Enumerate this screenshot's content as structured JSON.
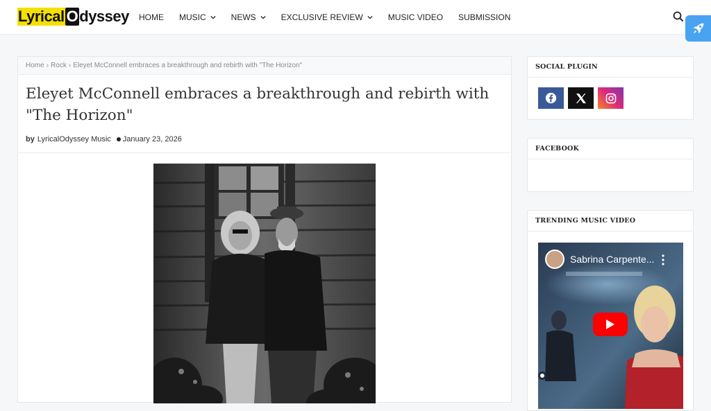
{
  "header": {
    "logo": {
      "part1": "Lyrical",
      "part2": "O",
      "part3": "dyssey"
    },
    "nav": [
      {
        "label": "HOME",
        "dropdown": false
      },
      {
        "label": "MUSIC",
        "dropdown": true
      },
      {
        "label": "NEWS",
        "dropdown": true
      },
      {
        "label": "EXCLUSIVE REVIEW",
        "dropdown": true
      },
      {
        "label": "MUSIC VIDEO",
        "dropdown": false
      },
      {
        "label": "SUBMISSION",
        "dropdown": false
      }
    ]
  },
  "breadcrumb": {
    "items": [
      "Home",
      "Rock",
      "Eleyet McConnell embraces a breakthrough and rebirth with \"The Horizon\""
    ],
    "separator": "›"
  },
  "post": {
    "title": "Eleyet McConnell embraces a breakthrough and rebirth with \"The Horizon\"",
    "by_label": "by",
    "author": "LyricalOdyssey Music",
    "date": "January 23, 2026"
  },
  "sidebar": {
    "social_title": "SOCIAL PLUGIN",
    "social_icons": [
      "facebook-icon",
      "x-icon",
      "instagram-icon"
    ],
    "facebook_title": "FACEBOOK",
    "trending_title": "TRENDING MUSIC VIDEO",
    "video_title": "Sabrina Carpente..."
  },
  "colors": {
    "logo_highlight": "#f4e000",
    "facebook": "#3b5998",
    "x": "#111111",
    "instagram": "#dd2a7b",
    "play_button": "#ff0000",
    "rocket_button": "#4aa3f0"
  }
}
